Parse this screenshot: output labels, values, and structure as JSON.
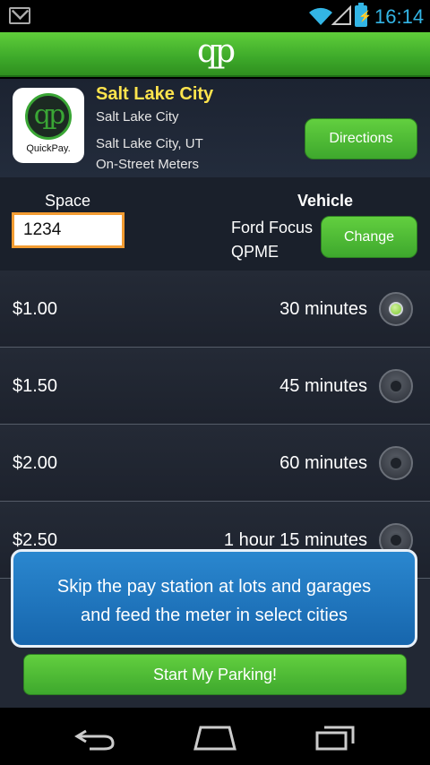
{
  "status_bar": {
    "time": "16:14",
    "battery_glyph": "⚡"
  },
  "app_bar": {
    "logo_text": "qp"
  },
  "location": {
    "logo_letters": "qp",
    "logo_brand": "QuickPay.",
    "title": "Salt Lake City",
    "subtitle": "Salt Lake City",
    "city_state": "Salt Lake City, UT",
    "meter_type": "On-Street Meters",
    "directions_label": "Directions"
  },
  "space": {
    "label": "Space",
    "value": "1234"
  },
  "vehicle": {
    "label": "Vehicle",
    "name": "Ford Focus",
    "plate": "QPME",
    "change_label": "Change"
  },
  "rates": [
    {
      "price": "$1.00",
      "duration": "30 minutes",
      "selected": true
    },
    {
      "price": "$1.50",
      "duration": "45 minutes",
      "selected": false
    },
    {
      "price": "$2.00",
      "duration": "60 minutes",
      "selected": false
    },
    {
      "price": "$2.50",
      "duration": "1 hour 15 minutes",
      "selected": false
    }
  ],
  "banner": {
    "line1": "Skip the pay station at lots and garages",
    "line2": "and feed the meter in select cities"
  },
  "start_label": "Start My Parking!",
  "colors": {
    "brand_green": "#3da92a",
    "title_yellow": "#ffe44d",
    "banner_blue": "#1f77c1",
    "input_border": "#f39c32"
  }
}
